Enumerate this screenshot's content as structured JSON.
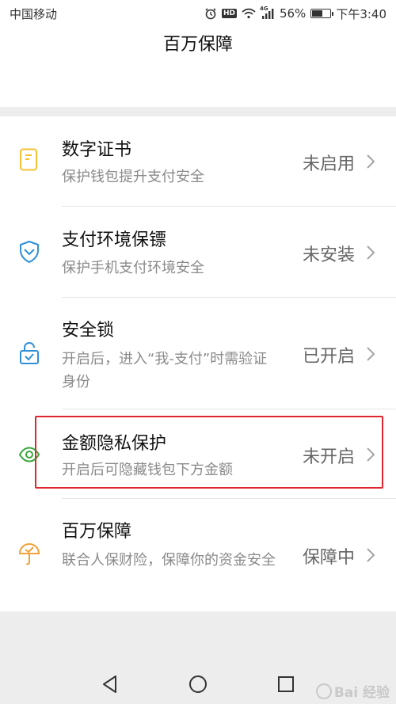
{
  "status_bar": {
    "carrier": "中国移动",
    "battery_percent": "56%",
    "time": "下午3:40",
    "network_badge": "HD",
    "network_type": "4G",
    "battery_level": 0.56
  },
  "header": {
    "title": "百万保障"
  },
  "items": [
    {
      "title": "数字证书",
      "subtitle": "保护钱包提升支付安全",
      "status": "未启用",
      "icon": "certificate-icon"
    },
    {
      "title": "支付环境保镖",
      "subtitle": "保护手机支付环境安全",
      "status": "未安装",
      "icon": "shield-icon"
    },
    {
      "title": "安全锁",
      "subtitle": "开启后，进入“我-支付”时需验证身份",
      "status": "已开启",
      "icon": "lock-icon"
    },
    {
      "title": "金额隐私保护",
      "subtitle": "开启后可隐藏钱包下方金额",
      "status": "未开启",
      "icon": "eye-icon"
    },
    {
      "title": "百万保障",
      "subtitle": "联合人保财险，保障你的资金安全",
      "status": "保障中",
      "icon": "umbrella-icon"
    }
  ],
  "watermark": {
    "text": "Bai 经验"
  },
  "colors": {
    "icon_yellow": "#f5c033",
    "icon_blue": "#2f8fd8",
    "icon_green": "#38a63b",
    "icon_orange": "#f0a13a",
    "highlight_red": "#e0262d"
  }
}
